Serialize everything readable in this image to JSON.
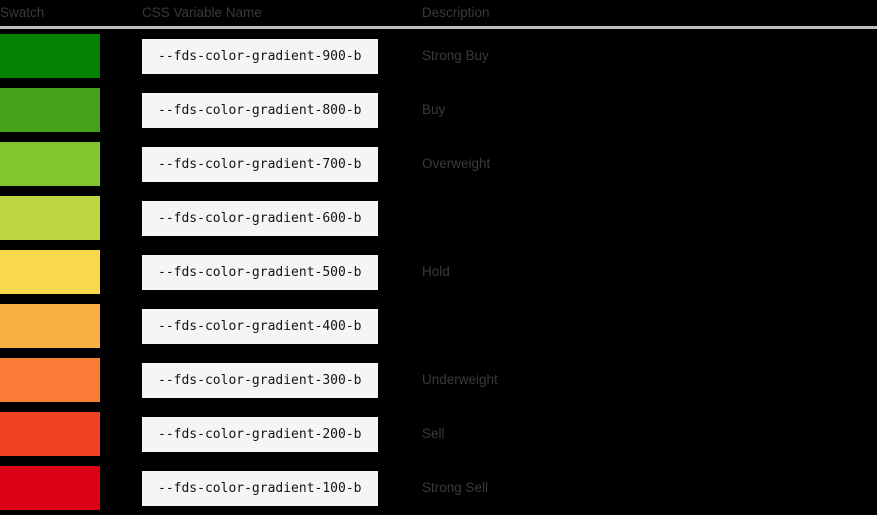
{
  "page": {
    "background": "#000000",
    "divider_color": "#b9bbbd",
    "chip_background": "#f4f5f5",
    "chip_text_color": "#141414",
    "header_text_color": "#3a3a3a",
    "description_text_color": "#3a3a3a"
  },
  "table": {
    "headers": {
      "swatch": "Swatch",
      "variable": "CSS Variable Name",
      "description": "Description"
    },
    "rows": [
      {
        "swatch_color": "#048204",
        "variable": "--fds-color-gradient-900-b",
        "description": "Strong Buy"
      },
      {
        "swatch_color": "#46a018",
        "variable": "--fds-color-gradient-800-b",
        "description": "Buy"
      },
      {
        "swatch_color": "#82c62f",
        "variable": "--fds-color-gradient-700-b",
        "description": "Overweight"
      },
      {
        "swatch_color": "#bed741",
        "variable": "--fds-color-gradient-600-b",
        "description": ""
      },
      {
        "swatch_color": "#f9d94b",
        "variable": "--fds-color-gradient-500-b",
        "description": "Hold"
      },
      {
        "swatch_color": "#f9af41",
        "variable": "--fds-color-gradient-400-b",
        "description": ""
      },
      {
        "swatch_color": "#f97b35",
        "variable": "--fds-color-gradient-300-b",
        "description": "Underweight"
      },
      {
        "swatch_color": "#ef4123",
        "variable": "--fds-color-gradient-200-b",
        "description": "Sell"
      },
      {
        "swatch_color": "#dc0113",
        "variable": "--fds-color-gradient-100-b",
        "description": "Strong Sell"
      }
    ]
  }
}
